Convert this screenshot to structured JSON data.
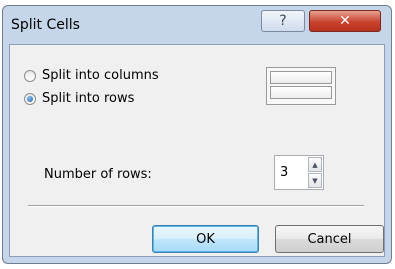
{
  "window": {
    "title": "Split Cells",
    "help_glyph": "?",
    "close_glyph": "✕"
  },
  "options": {
    "columns_label": "Split into columns",
    "rows_label": "Split into rows",
    "selected": "rows"
  },
  "rows": {
    "label": "Number of rows:",
    "value": "3",
    "up_glyph": "▲",
    "down_glyph": "▼"
  },
  "buttons": {
    "ok_label": "OK",
    "cancel_label": "Cancel"
  }
}
